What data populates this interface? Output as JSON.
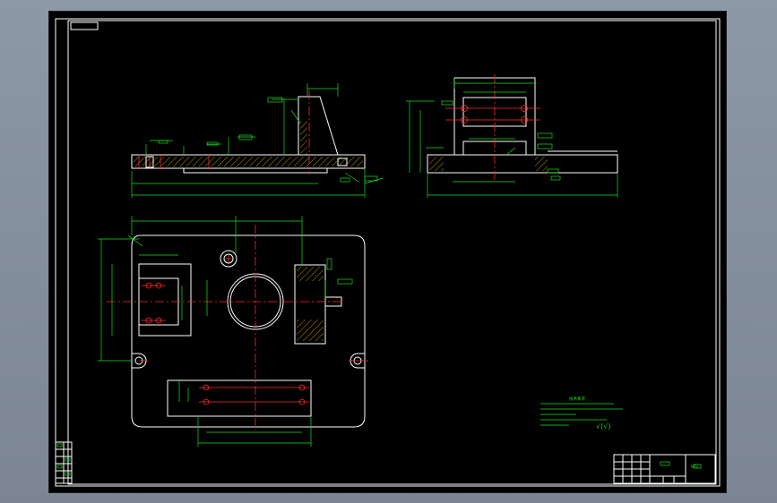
{
  "drawing": {
    "title_block_label": "REV",
    "tech_notes_heading": "技术要求",
    "surface_finish_symbol": "√(√)",
    "colors": {
      "background": "#000000",
      "outline": "#ffffff",
      "dimension": "#19e019",
      "centerline": "#ff2a2a",
      "hatch": "#ffd400",
      "viewport_frame": "#8d98a6"
    }
  }
}
